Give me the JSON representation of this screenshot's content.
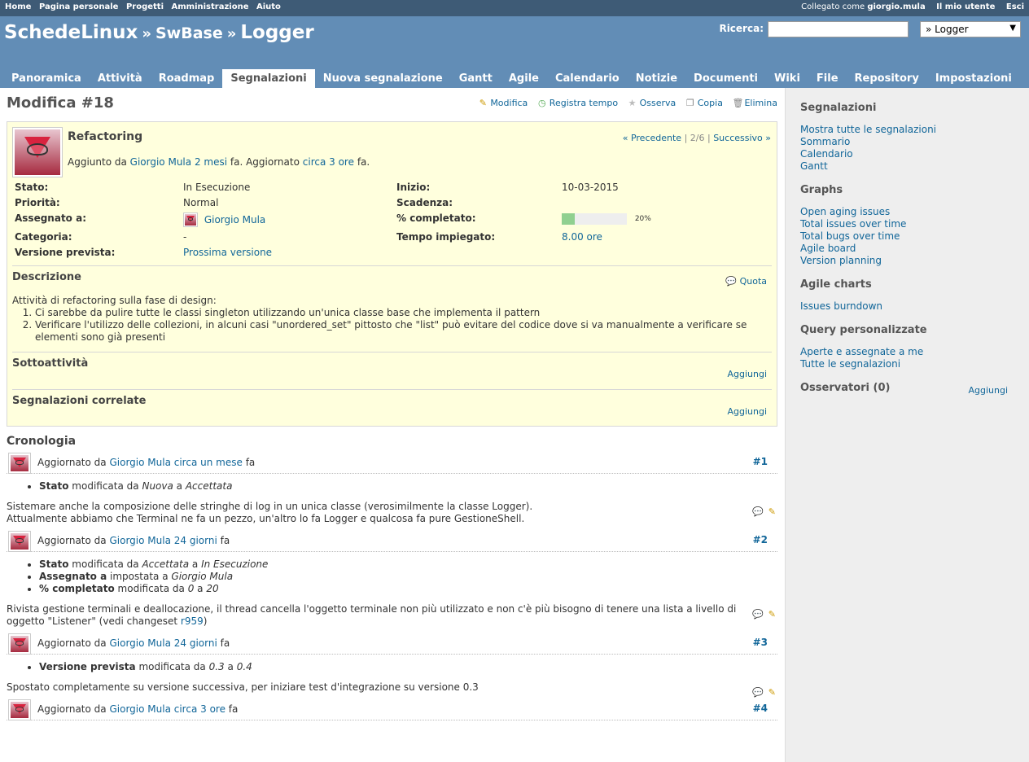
{
  "top_menu": {
    "left": [
      "Home",
      "Pagina personale",
      "Progetti",
      "Amministrazione",
      "Aiuto"
    ],
    "logged_label": "Collegato come",
    "user": "giorgio.mula",
    "my_account": "Il mio utente",
    "logout": "Esci"
  },
  "header": {
    "root": "SchedeLinux",
    "sep": "»",
    "parent": "SwBase",
    "project": "Logger",
    "search_label": "Ricerca:",
    "search_value": "",
    "jump_value": "» Logger"
  },
  "tabs": [
    "Panoramica",
    "Attività",
    "Roadmap",
    "Segnalazioni",
    "Nuova segnalazione",
    "Gantt",
    "Agile",
    "Calendario",
    "Notizie",
    "Documenti",
    "Wiki",
    "File",
    "Repository",
    "Impostazioni"
  ],
  "content": {
    "title": "Modifica #18",
    "actions": {
      "edit": "Modifica",
      "log_time": "Registra tempo",
      "watch": "Osserva",
      "copy": "Copia",
      "delete": "Elimina"
    },
    "issue": {
      "subject": "Refactoring",
      "nav_prev": "« Precedente",
      "nav_pos": "2/6",
      "nav_next": "Successivo »",
      "author_prefix": "Aggiunto da",
      "author": "Giorgio Mula",
      "created": "2 mesi",
      "updated_prefix": "fa. Aggiornato",
      "updated": "circa 3 ore",
      "updated_suffix": "fa.",
      "attributes": {
        "status_label": "Stato:",
        "status": "In Esecuzione",
        "priority_label": "Priorità:",
        "priority": "Normal",
        "assigned_label": "Assegnato a:",
        "assigned": "Giorgio Mula",
        "category_label": "Categoria:",
        "category": "-",
        "version_label": "Versione prevista:",
        "version": "Prossima versione",
        "start_label": "Inizio:",
        "start": "10-03-2015",
        "due_label": "Scadenza:",
        "due": "",
        "done_label": "% completato:",
        "done_pct": 20,
        "done_text": "20%",
        "spent_label": "Tempo impiegato:",
        "spent": "8.00 ore"
      },
      "description_title": "Descrizione",
      "quote": "Quota",
      "description_intro": "Attività di refactoring sulla fase di design:",
      "description_items": [
        "Ci sarebbe da pulire tutte le classi singleton utilizzando un'unica classe base che implementa il pattern",
        "Verificare l'utilizzo delle collezioni, in alcuni casi \"unordered_set\" pittosto che \"list\" può evitare del codice dove si va manualmente a verificare se elementi sono già presenti"
      ],
      "subtasks_title": "Sottoattività",
      "related_title": "Segnalazioni correlate",
      "add": "Aggiungi"
    },
    "history_title": "Cronologia",
    "journals": [
      {
        "prefix": "Aggiornato da",
        "author": "Giorgio Mula",
        "when": "circa un mese",
        "suffix": "fa",
        "num": "#1",
        "details": [
          {
            "field": "Stato",
            "verb": "modificata da",
            "from": "Nuova",
            "to": "Accettata"
          }
        ],
        "note_lines": [
          "Sistemare anche la composizione delle stringhe di log in un unica classe (verosimilmente la classe Logger).",
          "Attualmente abbiamo che Terminal ne fa un pezzo, un'altro lo fa Logger e qualcosa fa pure GestioneShell."
        ]
      },
      {
        "prefix": "Aggiornato da",
        "author": "Giorgio Mula",
        "when": "24 giorni",
        "suffix": "fa",
        "num": "#2",
        "details": [
          {
            "field": "Stato",
            "verb": "modificata da",
            "from": "Accettata",
            "to": "In Esecuzione"
          },
          {
            "field": "Assegnato a",
            "verb": "impostata a",
            "from": "",
            "to": "Giorgio Mula"
          },
          {
            "field": "% completato",
            "verb": "modificata da",
            "from": "0",
            "to": "20"
          }
        ],
        "note_text": "Rivista gestione terminali e deallocazione, il thread cancella l'oggetto terminale non più utilizzato e non c'è più bisogno di tenere una lista a livello di oggetto \"Listener\" (vedi changeset",
        "note_link": "r959",
        "note_end": ")"
      },
      {
        "prefix": "Aggiornato da",
        "author": "Giorgio Mula",
        "when": "24 giorni",
        "suffix": "fa",
        "num": "#3",
        "details": [
          {
            "field": "Versione prevista",
            "verb": "modificata da",
            "from": "0.3",
            "to": "0.4"
          }
        ],
        "note_lines": [
          "Spostato completamente su versione successiva, per iniziare test d'integrazione su versione 0.3"
        ]
      },
      {
        "prefix": "Aggiornato da",
        "author": "Giorgio Mula",
        "when": "circa 3 ore",
        "suffix": "fa",
        "num": "#4"
      }
    ]
  },
  "sidebar": {
    "issues_title": "Segnalazioni",
    "issues_links": [
      "Mostra tutte le segnalazioni",
      "Sommario",
      "Calendario",
      "Gantt"
    ],
    "graphs_title": "Graphs",
    "graphs_links": [
      "Open aging issues",
      "Total issues over time",
      "Total bugs over time",
      "Agile board",
      "Version planning"
    ],
    "agile_title": "Agile charts",
    "agile_links": [
      "Issues burndown"
    ],
    "queries_title": "Query personalizzate",
    "queries_links": [
      "Aperte e assegnate a me",
      "Tutte le segnalazioni"
    ],
    "watchers_title": "Osservatori (0)",
    "watchers_add": "Aggiungi"
  }
}
